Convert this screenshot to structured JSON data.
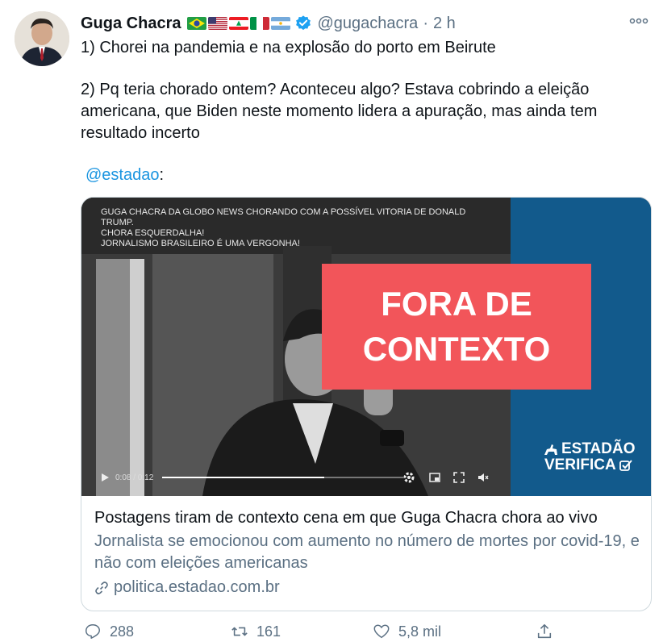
{
  "tweet": {
    "author_name": "Guga Chacra",
    "handle": "@gugachacra",
    "separator": "·",
    "time": "2 h",
    "text": [
      "1) Chorei na pandemia e na explosão do porto em Beirute",
      "2) Pq teria chorado ontem? Aconteceu algo? Estava cobrindo a eleição americana, que Biden neste momento lidera a apuração, mas ainda tem resultado incerto"
    ],
    "mention": "@estadao",
    "mention_suffix": ":"
  },
  "card": {
    "overlay_lines": [
      "GUGA CHACRA DA GLOBO NEWS CHORANDO COM A POSSÍVEL VITORIA DE DONALD TRUMP.",
      "CHORA ESQUERDALHA!",
      "JORNALISMO BRASILEIRO É UMA VERGONHA!"
    ],
    "stamp_line1": "FORA DE",
    "stamp_line2": "CONTEXTO",
    "logo_line1": "ESTADÃO",
    "logo_line2": "VERIFICA",
    "video_time": "0:08 / 0:12",
    "video_progress": 0.67,
    "title": "Postagens tiram de contexto cena em que Guga Chacra chora ao vivo",
    "description": "Jornalista se emocionou com aumento no número de mortes por covid-19, e não com eleições americanas",
    "link": "politica.estadao.com.br"
  },
  "actions": {
    "replies": "288",
    "retweets": "161",
    "likes": "5,8 mil"
  },
  "colors": {
    "link_blue": "#1b95e0",
    "muted_text": "#5b7083",
    "stamp_red": "#f2555a",
    "panel_blue": "#125a8c",
    "verified_blue": "#1da1f2"
  }
}
